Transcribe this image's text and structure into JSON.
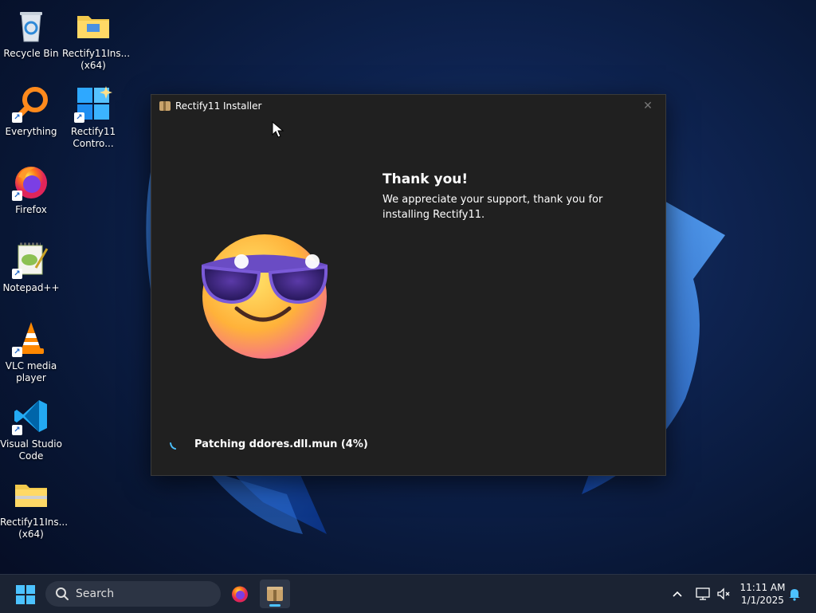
{
  "desktop": {
    "icons": [
      {
        "label": "Recycle Bin"
      },
      {
        "label": "Rectify11Ins... (x64)"
      },
      {
        "label": "Everything"
      },
      {
        "label": "Rectify11 Contro..."
      },
      {
        "label": "Firefox"
      },
      {
        "label": "Notepad++"
      },
      {
        "label": "VLC media player"
      },
      {
        "label": "Visual Studio Code"
      },
      {
        "label": "Rectify11Ins... (x64)"
      }
    ]
  },
  "installer": {
    "title": "Rectify11 Installer",
    "close_glyph": "✕",
    "heading": "Thank you!",
    "message": "We appreciate your support, thank you for installing Rectify11.",
    "status": "Patching ddores.dll.mun (4%)",
    "progress_percent": 4
  },
  "taskbar": {
    "search_label": "Search",
    "apps": [
      "firefox-icon",
      "installer-icon"
    ],
    "time": "11:11 AM",
    "date": "1/1/2025",
    "accent": "#4cc2ff"
  }
}
